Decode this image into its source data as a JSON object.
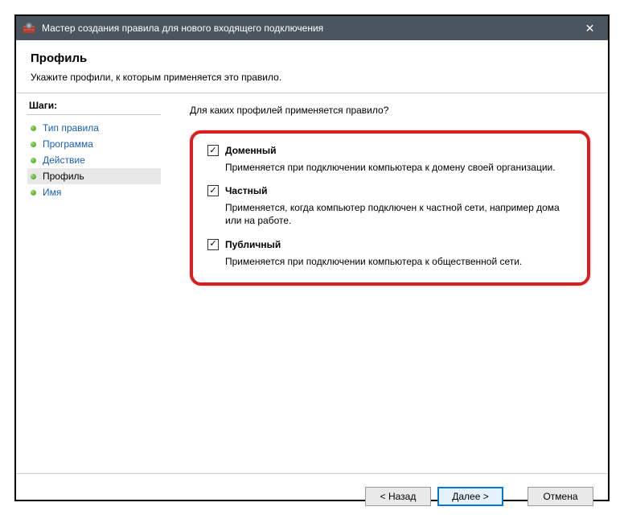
{
  "window": {
    "title": "Мастер создания правила для нового входящего подключения"
  },
  "header": {
    "title": "Профиль",
    "subtitle": "Укажите профили, к которым применяется это правило."
  },
  "sidebar": {
    "steps_label": "Шаги:",
    "items": [
      {
        "label": "Тип правила"
      },
      {
        "label": "Программа"
      },
      {
        "label": "Действие"
      },
      {
        "label": "Профиль"
      },
      {
        "label": "Имя"
      }
    ],
    "current_index": 3
  },
  "main": {
    "prompt": "Для каких профилей применяется правило?",
    "checkboxes": [
      {
        "label": "Доменный",
        "checked": true,
        "description": "Применяется при подключении компьютера к домену своей организации."
      },
      {
        "label": "Частный",
        "checked": true,
        "description": "Применяется, когда компьютер подключен к частной сети, например дома или на работе."
      },
      {
        "label": "Публичный",
        "checked": true,
        "description": "Применяется при подключении компьютера к общественной сети."
      }
    ]
  },
  "footer": {
    "back": "< Назад",
    "next": "Далее >",
    "cancel": "Отмена"
  }
}
